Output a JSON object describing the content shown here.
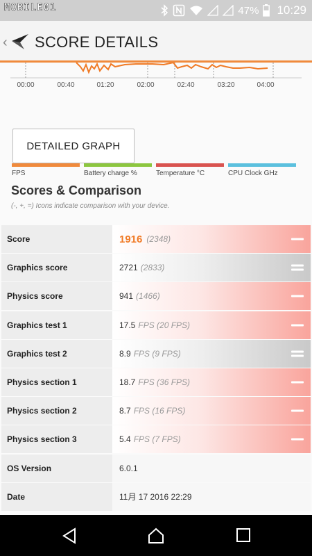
{
  "status_bar": {
    "watermark": "MOBILE01",
    "battery_percent": "47%",
    "time": "10:29",
    "icons": [
      "bluetooth-icon",
      "nfc-icon",
      "wifi-icon",
      "signal-icon",
      "signal-icon",
      "battery-icon"
    ]
  },
  "app_bar": {
    "title": "SCORE DETAILS",
    "accent": "#f08a3c"
  },
  "chart": {
    "x_ticks": [
      "00:00",
      "00:40",
      "01:20",
      "02:00",
      "02:40",
      "03:20",
      "04:00"
    ],
    "legend": [
      {
        "label": "FPS",
        "color": "#f08a3c"
      },
      {
        "label": "Battery charge %",
        "color": "#8cc63f"
      },
      {
        "label": "Temperature °C",
        "color": "#d9534f"
      },
      {
        "label": "CPU Clock GHz",
        "color": "#5bc0de"
      }
    ]
  },
  "detailed_graph_button": "DETAILED GRAPH",
  "scores_section": {
    "title": "Scores & Comparison",
    "subtitle": "(-, +, =) Icons indicate comparison with your device."
  },
  "rows": [
    {
      "label": "Score",
      "value": "1916",
      "compare": "(2348)",
      "indicator": "minus",
      "style": "red",
      "big": true
    },
    {
      "label": "Graphics score",
      "value": "2721",
      "compare": "(2833)",
      "indicator": "equal",
      "style": "gray"
    },
    {
      "label": "Physics score",
      "value": "941",
      "compare": "(1466)",
      "indicator": "minus",
      "style": "red"
    },
    {
      "label": "Graphics test 1",
      "value": "17.5",
      "compare": "FPS (20 FPS)",
      "indicator": "minus",
      "style": "red"
    },
    {
      "label": "Graphics test 2",
      "value": "8.9",
      "compare": "FPS (9 FPS)",
      "indicator": "equal",
      "style": "gray"
    },
    {
      "label": "Physics section 1",
      "value": "18.7",
      "compare": "FPS (36 FPS)",
      "indicator": "minus",
      "style": "red"
    },
    {
      "label": "Physics section 2",
      "value": "8.7",
      "compare": "FPS (16 FPS)",
      "indicator": "minus",
      "style": "red"
    },
    {
      "label": "Physics section 3",
      "value": "5.4",
      "compare": "FPS (7 FPS)",
      "indicator": "minus",
      "style": "red"
    },
    {
      "label": "OS Version",
      "value": "6.0.1",
      "compare": "",
      "indicator": "none",
      "style": "plain"
    },
    {
      "label": "Date",
      "value": "11月 17 2016 22:29",
      "compare": "",
      "indicator": "none",
      "style": "plain"
    }
  ],
  "nav_bar": [
    "back-icon",
    "home-icon",
    "recents-icon"
  ]
}
